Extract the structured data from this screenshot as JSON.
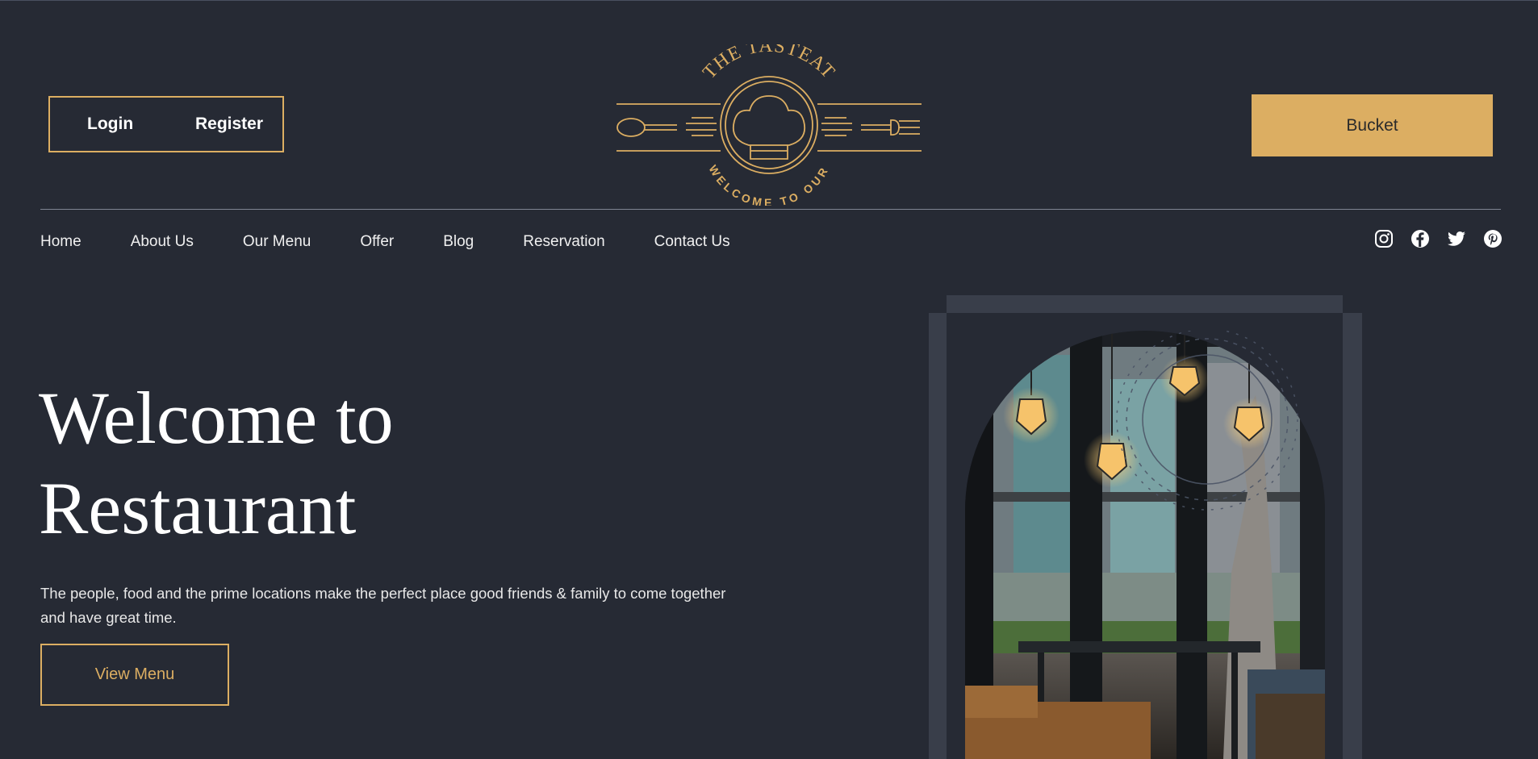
{
  "header": {
    "login_label": "Login",
    "register_label": "Register",
    "bucket_label": "Bucket",
    "logo": {
      "top_text": "THE TASTEAT",
      "bottom_text": "WELCOME TO OUR"
    }
  },
  "nav": {
    "items": [
      {
        "label": "Home"
      },
      {
        "label": "About Us"
      },
      {
        "label": "Our Menu"
      },
      {
        "label": "Offer"
      },
      {
        "label": "Blog"
      },
      {
        "label": "Reservation"
      },
      {
        "label": "Contact Us"
      }
    ]
  },
  "socials": [
    "instagram-icon",
    "facebook-icon",
    "twitter-icon",
    "pinterest-icon"
  ],
  "hero": {
    "title_line1": "Welcome to",
    "title_line2": "Restaurant",
    "description": "The people, food and the prime locations make the perfect place good friends & family to come together and have great time.",
    "cta_label": "View Menu"
  },
  "colors": {
    "background": "#262a34",
    "accent": "#dcae62",
    "frame": "#393e4a",
    "text": "#ffffff"
  }
}
